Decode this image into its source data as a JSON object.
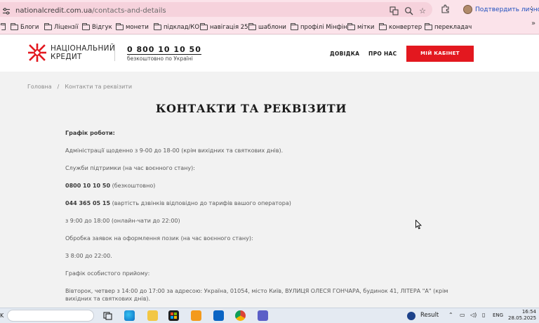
{
  "browser": {
    "url_domain": "nationalcredit.com.ua",
    "url_path": "/contacts-and-details",
    "profile_label": "Подтвердить личность"
  },
  "bookmarks": [
    {
      "label": "Блоги"
    },
    {
      "label": "Ліцензії"
    },
    {
      "label": "Відгук"
    },
    {
      "label": "монети"
    },
    {
      "label": "підклад/КО"
    },
    {
      "label": "навігація 25"
    },
    {
      "label": "шаблони"
    },
    {
      "label": "профілі Мінфін"
    },
    {
      "label": "мітки"
    },
    {
      "label": "конвертер"
    },
    {
      "label": "перекладач"
    }
  ],
  "site": {
    "logo_line1": "НАЦІОНАЛЬНИЙ",
    "logo_line2": "КРЕДИТ",
    "phone": "0 800 10 10 50",
    "phone_note": "безкоштовно по Україні",
    "nav": [
      "ДОВІДКА",
      "ПРО НАС"
    ],
    "cabinet_button": "МІЙ КАБІНЕТ",
    "brand_color": "#e3181f"
  },
  "breadcrumb": {
    "home": "Головна",
    "separator": "/",
    "current": "Контакти та реквізити"
  },
  "page": {
    "title": "КОНТАКТИ ТА РЕКВІЗИТИ",
    "schedule_heading": "Графік роботи:",
    "admin_hours": "Адміністрації щоденно з 9-00 до 18-00 (крім вихідних та святкових днів).",
    "support_heading": "Служби підтримки (на час воєнного стану):",
    "phone1": "0800 10 10 50",
    "phone1_note": " (безкоштовно)",
    "phone2": "044 365 05 15",
    "phone2_note": " (вартість дзвінків відповідно до тарифів вашого оператора)",
    "support_hours": "з 9:00 до 18:00 (онлайн-чати до 22:00)",
    "loans_heading": "Обробка заявок на оформлення позик (на час воєнного стану):",
    "loans_hours": "З 8:00 до 22:00.",
    "reception_heading": "Графік особистого прийому:",
    "reception_line1": "Вівторок, четвер з 14:00 до 17:00 за адресою: Україна, 01054, місто Київ, ВУЛИЦЯ ОЛЕСЯ ГОНЧАРА, будинок 41, ЛІТЕРА \"А\" (крім",
    "reception_line2": "вихідних та святкових днів)."
  },
  "taskbar": {
    "left_text": "K",
    "weather": "Result",
    "lang": "ENG",
    "time": "16:54",
    "date": "28.05.2025"
  }
}
